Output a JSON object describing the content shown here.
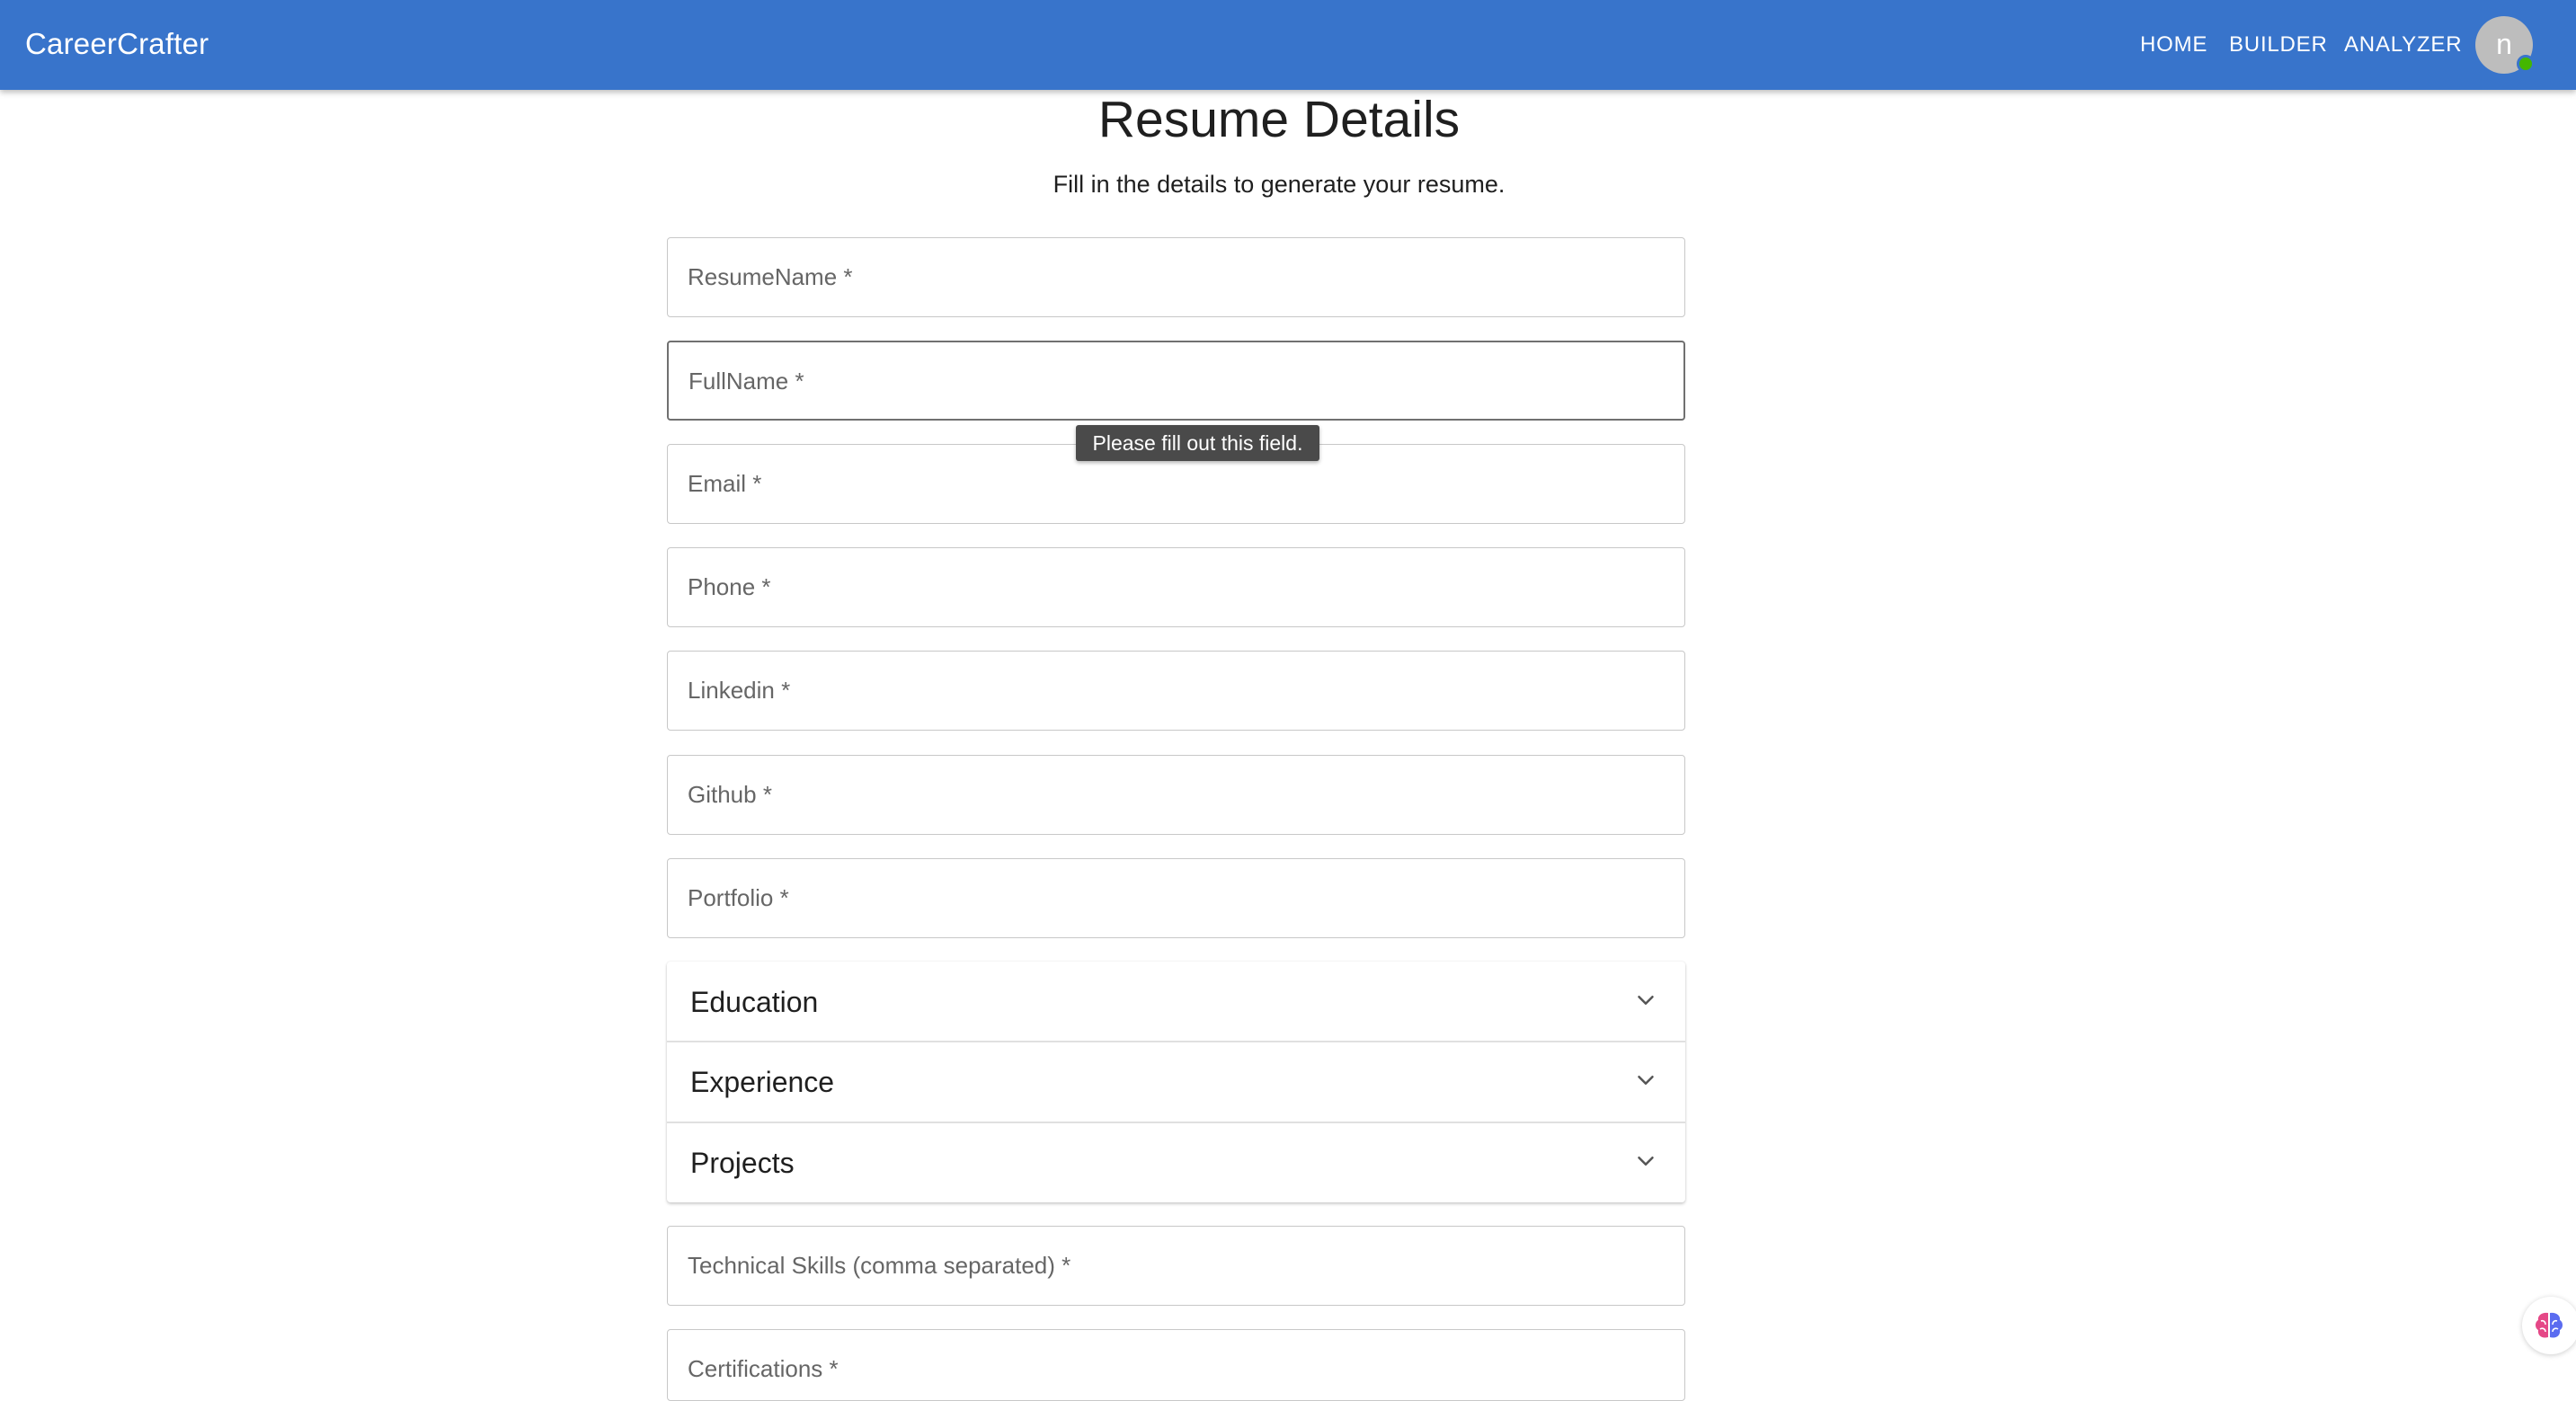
{
  "appbar": {
    "brand": "CareerCrafter",
    "nav": [
      "HOME",
      "BUILDER",
      "ANALYZER"
    ],
    "avatar_letter": "n",
    "color": "#3874cb"
  },
  "page": {
    "title": "Resume Details",
    "subtitle": "Fill in the details to generate your resume."
  },
  "fields": {
    "resume_name": "ResumeName *",
    "full_name": "FullName *",
    "email": "Email *",
    "phone": "Phone *",
    "linkedin": "Linkedin *",
    "github": "Github *",
    "portfolio": "Portfolio *",
    "technical_skills": "Technical Skills (comma separated) *",
    "certifications": "Certifications *"
  },
  "validation": {
    "tooltip": "Please fill out this field."
  },
  "sections": {
    "education": "Education",
    "experience": "Experience",
    "projects": "Projects"
  },
  "icons": {
    "chevron": "chevron-down-icon",
    "fab": "brain-icon"
  }
}
